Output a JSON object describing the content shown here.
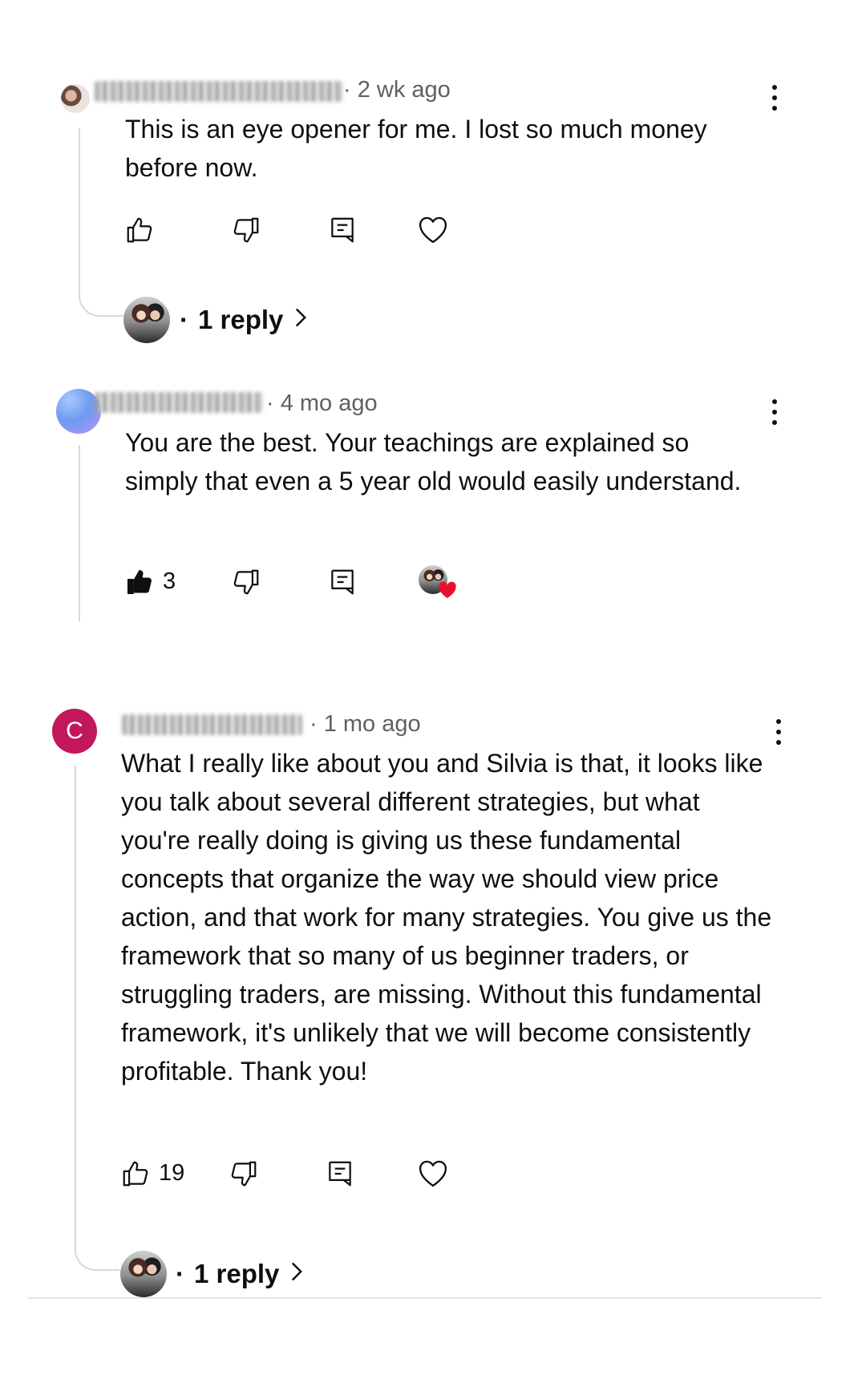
{
  "comments": [
    {
      "time": "· 2 wk ago",
      "text": "This is an eye opener for me. I lost so much money before now.",
      "reply_dot": "·",
      "reply_label": "1 reply"
    },
    {
      "time": "· 4 mo ago",
      "text": "You are the best. Your teachings are explained so simply that even a 5 year old would easily understand.",
      "like_count": "3"
    },
    {
      "avatar_letter": "C",
      "time": "· 1 mo ago",
      "text": "What I really like about you and Silvia is that, it looks like you talk about several different strategies, but what you're really doing is giving us these fundamental concepts that organize the way we should view price action, and that work for many strategies. You give us the framework that so many of us beginner traders, or struggling traders, are missing. Without this fundamental framework, it's unlikely that we will become consistently profitable. Thank you!",
      "like_count": "19",
      "reply_dot": "·",
      "reply_label": "1 reply"
    }
  ],
  "icons": {
    "like": "thumbs-up-icon",
    "dislike": "thumbs-down-icon",
    "reply": "reply-comment-icon",
    "heart": "heart-icon",
    "more": "more-vertical-icon",
    "chevron": "chevron-right-icon"
  },
  "colors": {
    "avatar_c": "#c2185b",
    "heart_red": "#e8112d",
    "text": "#0f0f0f",
    "meta": "#606060"
  }
}
